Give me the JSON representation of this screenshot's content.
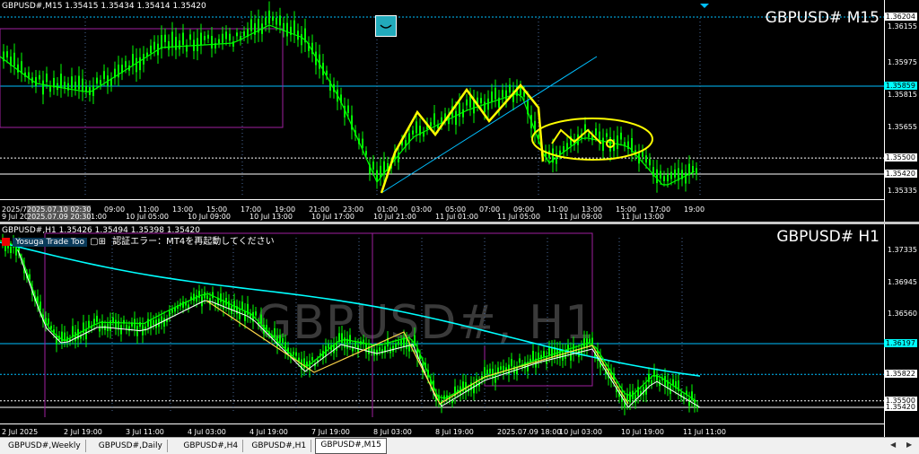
{
  "top": {
    "info": "GBPUSD#,M15 1.35415 1.35434 1.35414 1.35420",
    "symbol": "GBPUSD#  M15",
    "prices": [
      {
        "label": "1.36204",
        "y": 1.36204,
        "style": "box"
      },
      {
        "label": "1.36155",
        "y": 1.36155,
        "style": "plain"
      },
      {
        "label": "1.35975",
        "y": 1.35975,
        "style": "plain"
      },
      {
        "label": "1.35859",
        "y": 1.35859,
        "style": "box-c"
      },
      {
        "label": "1.35815",
        "y": 1.35815,
        "style": "plain"
      },
      {
        "label": "1.35655",
        "y": 1.35655,
        "style": "plain"
      },
      {
        "label": "1.35500",
        "y": 1.355,
        "style": "box"
      },
      {
        "label": "1.35420",
        "y": 1.3542,
        "style": "box"
      },
      {
        "label": "1.35335",
        "y": 1.35335,
        "style": "plain"
      }
    ],
    "time_row1": [
      "2025/7/",
      "05:00",
      "07:00",
      "09:00",
      "11:00",
      "13:00",
      "15:00",
      "17:00",
      "19:00",
      "21:00",
      "23:00",
      "01:00",
      "03:00",
      "05:00",
      "07:00",
      "09:00",
      "11:00",
      "13:00",
      "15:00",
      "17:00",
      "19:00"
    ],
    "time_row2": [
      "9 Jul 20",
      "10 Jul 01:00",
      "10 Jul 05:00",
      "10 Jul 09:00",
      "10 Jul 13:00",
      "10 Jul 17:00",
      "10 Jul 21:00",
      "11 Jul 01:00",
      "11 Jul 05:00",
      "11 Jul 09:00",
      "11 Jul 13:00"
    ],
    "time_highlight1": "2025.07.10 02:30",
    "time_highlight2": "2025.07.09 20:30"
  },
  "bottom": {
    "info": "GBPUSD#,H1 1.35426 1.35494 1.35398 1.35420",
    "symbol": "GBPUSD#  H1",
    "watermark": "GBPUSD#, H1",
    "tool_label": "Yosuga Trade Too",
    "error_text": "認証エラー：MT4を再起動してください",
    "prices": [
      {
        "label": "1.37335",
        "y": 1.37335,
        "style": "plain"
      },
      {
        "label": "1.36945",
        "y": 1.36945,
        "style": "plain"
      },
      {
        "label": "1.36560",
        "y": 1.3656,
        "style": "plain"
      },
      {
        "label": "1.36197",
        "y": 1.36197,
        "style": "box-c"
      },
      {
        "label": "1.35822",
        "y": 1.35822,
        "style": "box"
      },
      {
        "label": "1.35500",
        "y": 1.355,
        "style": "box"
      },
      {
        "label": "1.35420",
        "y": 1.3542,
        "style": "box"
      }
    ],
    "time_labels": [
      "2 Jul 2025",
      "2 Jul 19:00",
      "3 Jul 11:00",
      "4 Jul 03:00",
      "4 Jul 19:00",
      "7 Jul 19:00",
      "8 Jul 03:00",
      "8 Jul 19:00",
      "2025.07.09 18:00",
      "10 Jul 03:00",
      "10 Jul 19:00",
      "11 Jul 11:00"
    ]
  },
  "tabs": [
    "GBPUSD#,Weekly",
    "GBPUSD#,Daily",
    "GBPUSD#,H4",
    "GBPUSD#,H1",
    "GBPUSD#,M15"
  ],
  "active_tab": "GBPUSD#,M15",
  "colors": {
    "candle": "#00ff00",
    "ma_fast": "#00ff00",
    "ma_slow": "#00ffff",
    "annotation": "#ffff00",
    "box": "#a020a0",
    "hline": "#00bfff"
  }
}
